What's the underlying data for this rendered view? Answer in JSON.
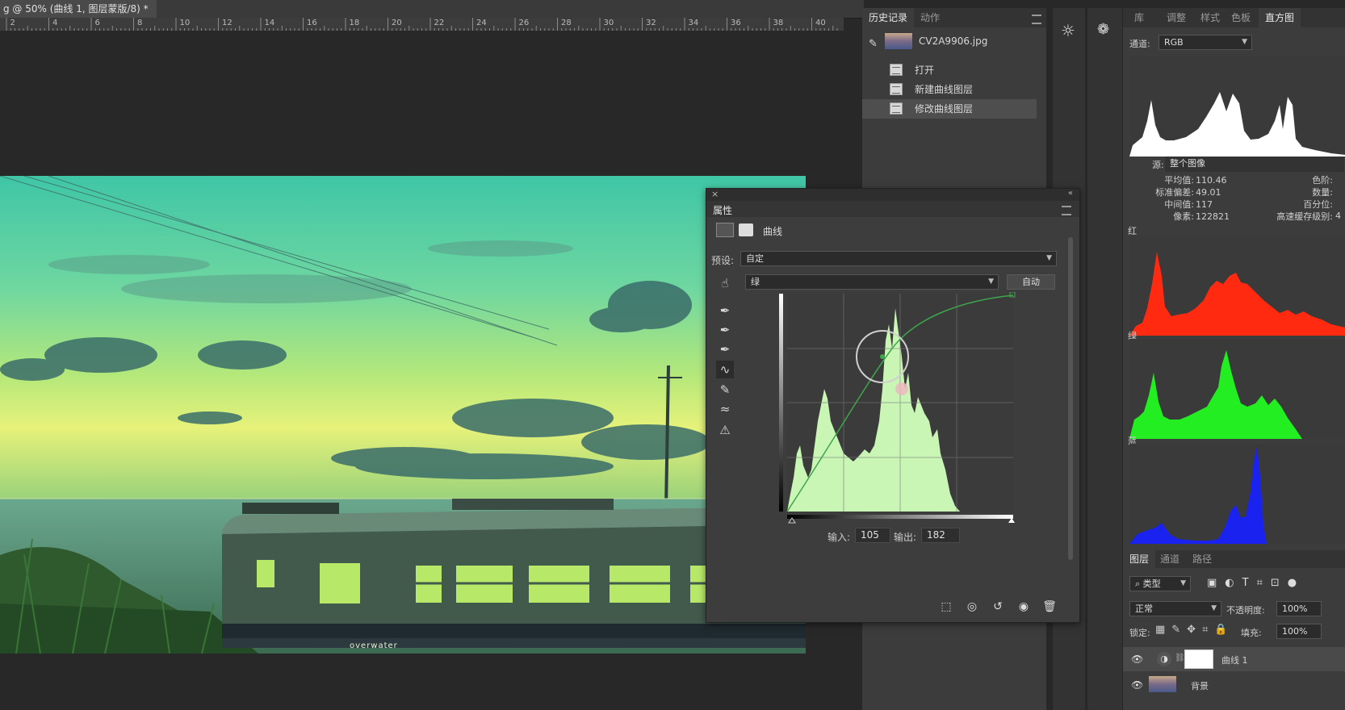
{
  "document": {
    "tab_title": "g @ 50% (曲线 1, 图层蒙版/8) *"
  },
  "ruler": {
    "ticks": [
      "2",
      "4",
      "6",
      "8",
      "10",
      "12",
      "14",
      "16",
      "18",
      "20",
      "22",
      "24",
      "26",
      "28",
      "30",
      "32",
      "34",
      "36",
      "38",
      "40"
    ]
  },
  "canvas": {
    "watermark": "overwater"
  },
  "history_panel": {
    "tabs": [
      "历史记录",
      "动作"
    ],
    "snapshot": "CV2A9906.jpg",
    "items": [
      "打开",
      "新建曲线图层",
      "修改曲线图层"
    ],
    "selected_index": 2
  },
  "properties": {
    "title": "属性",
    "type_label": "曲线",
    "preset_label": "预设:",
    "preset_value": "自定",
    "channel_value": "绿",
    "auto_button": "自动",
    "input_label": "输入:",
    "input_value": "105",
    "output_label": "输出:",
    "output_value": "182",
    "curve_color": "#3ea64a",
    "histogram_color": "#c9f5b5"
  },
  "right_panel": {
    "tabs": [
      "库",
      "调整",
      "样式",
      "色板",
      "直方图"
    ],
    "active_tab": "直方图",
    "channel_label": "通道:",
    "channel_value": "RGB",
    "source_label": "源:",
    "source_value": "整个图像",
    "stats_left": [
      {
        "label": "平均值:",
        "value": "110.46"
      },
      {
        "label": "标准偏差:",
        "value": "49.01"
      },
      {
        "label": "中间值:",
        "value": "117"
      },
      {
        "label": "像素:",
        "value": "122821"
      }
    ],
    "stats_right": [
      {
        "label": "色阶:",
        "value": ""
      },
      {
        "label": "数量:",
        "value": ""
      },
      {
        "label": "百分位:",
        "value": ""
      },
      {
        "label": "高速缓存级别:",
        "value": "4"
      }
    ],
    "channel_names": {
      "red": "红",
      "green": "绿",
      "blue": "蓝"
    },
    "colors": {
      "rgb": "#ffffff",
      "red": "#ff2a10",
      "green": "#22ee22",
      "blue": "#1a22f0"
    }
  },
  "layers_panel": {
    "tabs": [
      "图层",
      "通道",
      "路径"
    ],
    "filter_label": "类型",
    "blend_mode": "正常",
    "opacity_label": "不透明度:",
    "opacity_value": "100%",
    "lock_label": "锁定:",
    "fill_label": "填充:",
    "fill_value": "100%",
    "layers": [
      {
        "name": "曲线 1",
        "type": "adjustment"
      },
      {
        "name": "背景",
        "type": "image"
      }
    ]
  }
}
